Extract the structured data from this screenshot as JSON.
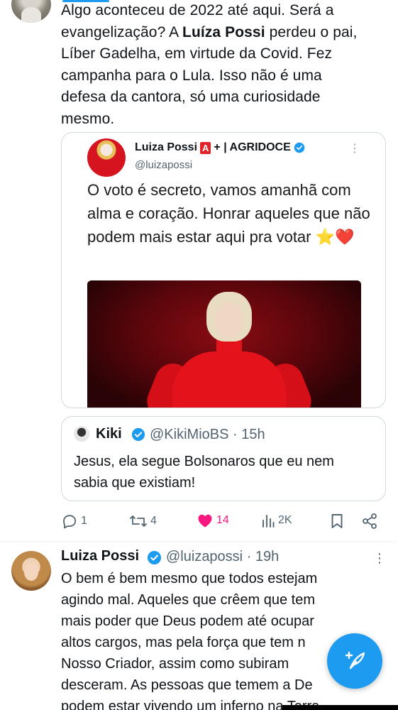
{
  "tweet1": {
    "text_lines": [
      "Algo aconteceu de 2022 até aqui. Será a",
      "evangelização? A ",
      "Luíza Possi",
      " perdeu o pai,",
      "Líber Gadelha, em virtude da Covid. Fez",
      "campanha para o Lula. Isso não é uma",
      "defesa da cantora, só uma curiosidade",
      "mesmo."
    ],
    "embedded_post": {
      "name": "Luiza Possi",
      "badge": "A",
      "name_suffix": "+ | AGRIDOCE",
      "handle": "@luizapossi",
      "more": "⋮",
      "text": "O voto é secreto, vamos amanhã com alma e coração. Honrar aqueles que não podem mais estar aqui pra votar ⭐❤️"
    },
    "quote": {
      "name": "Kiki",
      "handle": "@KikiMioBS",
      "separator": "·",
      "time": "15h",
      "text": "Jesus, ela segue Bolsonaros que eu nem sabia que existiam!"
    },
    "actions": {
      "replies": "1",
      "retweets": "4",
      "likes": "14",
      "views": "2K"
    }
  },
  "tweet2": {
    "name": "Luiza Possi",
    "handle": "@luizapossi",
    "separator": "·",
    "time": "19h",
    "more": "⋮",
    "text_lines": [
      "O bem é bem mesmo que todos estejam",
      "agindo mal. Aqueles que crêem que tem",
      "mais poder que Deus podem até ocupar",
      "altos cargos, mas pela força que tem n",
      "Nosso Criador, assim como subiram",
      "desceram. As pessoas que temem a De",
      "podem estar vivendo um inferno na Terra"
    ]
  },
  "colors": {
    "accent": "#1d9bf0",
    "like": "#f91880",
    "secondary_text": "#536471",
    "badge_red": "#e1232a"
  },
  "icons": {
    "reply": "reply-icon",
    "retweet": "retweet-icon",
    "like": "heart-icon",
    "views": "views-icon",
    "bookmark": "bookmark-icon",
    "share": "share-icon",
    "verified": "verified-icon",
    "compose": "compose-icon"
  }
}
